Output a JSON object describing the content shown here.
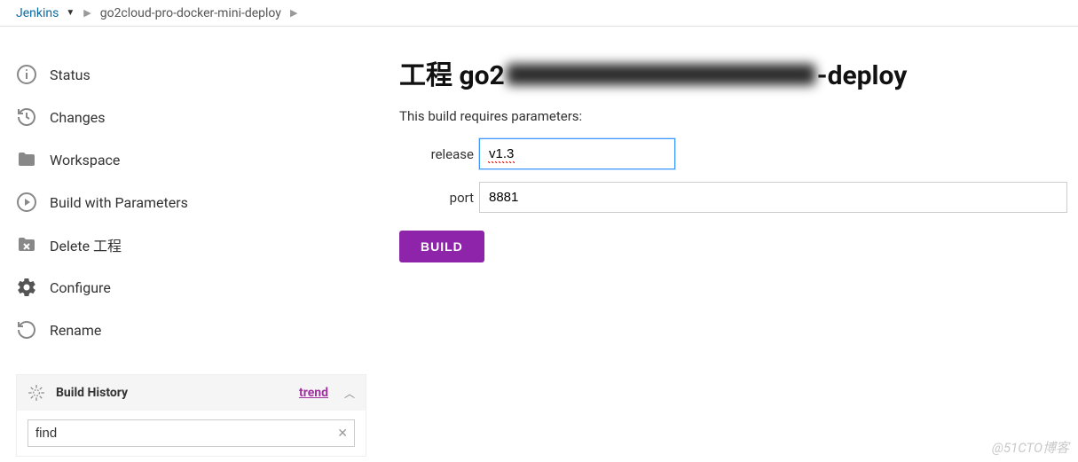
{
  "breadcrumb": {
    "root": "Jenkins",
    "job_name": "go2cloud-pro-docker-mini-deploy"
  },
  "sidebar": {
    "items": [
      {
        "label": "Status"
      },
      {
        "label": "Changes"
      },
      {
        "label": "Workspace"
      },
      {
        "label": "Build with Parameters"
      },
      {
        "label": "Delete 工程"
      },
      {
        "label": "Configure"
      },
      {
        "label": "Rename"
      }
    ]
  },
  "build_history": {
    "title": "Build History",
    "trend_label": "trend",
    "search_value": "find"
  },
  "main": {
    "title_prefix": "工程 go2",
    "title_suffix": "-deploy",
    "requires_msg": "This build requires parameters:",
    "params": [
      {
        "label": "release",
        "value": "v1.3"
      },
      {
        "label": "port",
        "value": "8881"
      }
    ],
    "build_button": "BUILD"
  },
  "watermark": "@51CTO博客"
}
